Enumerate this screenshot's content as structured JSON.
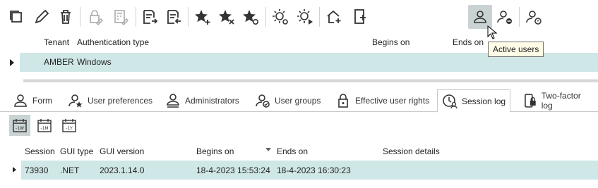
{
  "toolbar": {
    "buttons": [
      {
        "icon": "copy-icon"
      },
      {
        "icon": "edit-icon"
      },
      {
        "icon": "delete-icon"
      },
      {
        "icon": "lock-edit-icon"
      },
      {
        "icon": "calculator-edit-icon"
      },
      {
        "icon": "export-list-icon"
      },
      {
        "icon": "import-list-icon"
      },
      {
        "icon": "star-add-icon"
      },
      {
        "icon": "star-remove-icon"
      },
      {
        "icon": "star-refresh-icon"
      },
      {
        "icon": "sun-settings-icon"
      },
      {
        "icon": "sun-play-icon"
      },
      {
        "icon": "home-add-icon"
      },
      {
        "icon": "device-add-icon"
      },
      {
        "icon": "active-users-icon"
      },
      {
        "icon": "user-remove-icon"
      },
      {
        "icon": "user-time-icon"
      }
    ],
    "tooltip": "Active users"
  },
  "top_grid": {
    "columns": [
      "Tenant",
      "Authentication type",
      "Begins on",
      "Ends on"
    ],
    "rows": [
      {
        "tenant": "AMBER",
        "auth_type": "Windows",
        "begins_on": "",
        "ends_on": ""
      }
    ]
  },
  "tabs": [
    {
      "label": "Form",
      "icon": "user-icon"
    },
    {
      "label": "User preferences",
      "icon": "user-star-icon"
    },
    {
      "label": "Administrators",
      "icon": "admin-icon"
    },
    {
      "label": "User groups",
      "icon": "user-group-icon"
    },
    {
      "label": "Effective user rights",
      "icon": "lock-icon"
    },
    {
      "label": "Session log",
      "icon": "clock-user-icon",
      "active": true
    },
    {
      "label": "Two-factor log",
      "icon": "phone-lock-icon"
    }
  ],
  "period_buttons": [
    {
      "label": "-1W",
      "active": true
    },
    {
      "label": "-1M",
      "active": false
    },
    {
      "label": "-1Y",
      "active": false
    }
  ],
  "session_grid": {
    "columns": [
      "Session",
      "GUI type",
      "GUI version",
      "Begins on",
      "Ends on",
      "Session details"
    ],
    "rows": [
      {
        "session": "73930",
        "gui_type": ".NET",
        "gui_version": "2023.1.14.0",
        "begins_on": "18-4-2023 15:53:24",
        "ends_on": "18-4-2023 16:30:23",
        "details": ""
      }
    ]
  },
  "colors": {
    "selected_row": "#cfe7e6",
    "active_button": "#c9d3d3",
    "icon": "#333333"
  }
}
